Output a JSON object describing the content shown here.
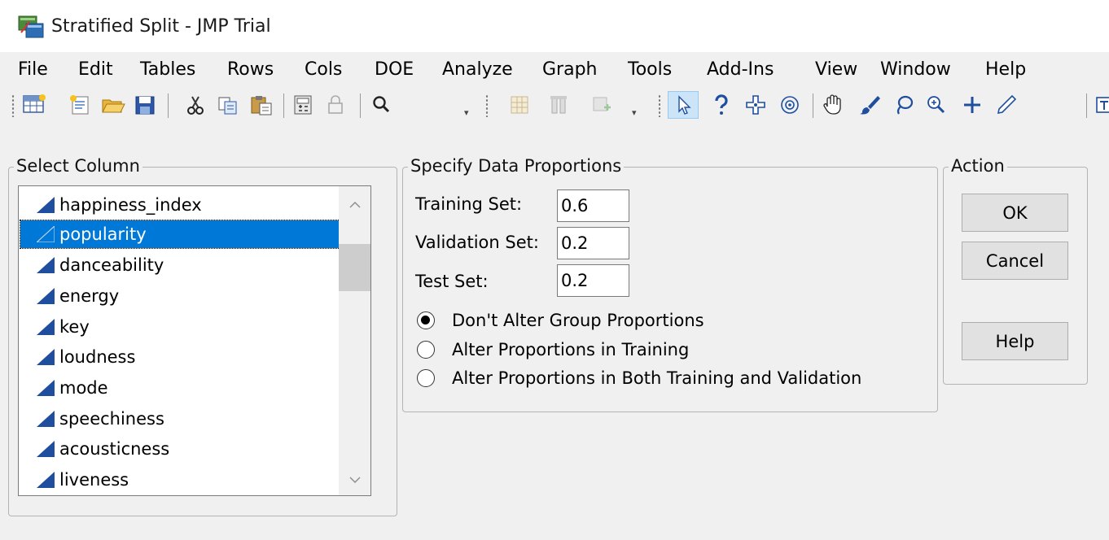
{
  "window": {
    "title": "Stratified Split - JMP Trial",
    "icon": "jmp-app-icon"
  },
  "menu": [
    "File",
    "Edit",
    "Tables",
    "Rows",
    "Cols",
    "DOE",
    "Analyze",
    "Graph",
    "Tools",
    "Add-Ins",
    "View",
    "Window",
    "Help"
  ],
  "toolbar_icons": [
    "new-data-table-icon",
    "new-script-icon",
    "open-folder-icon",
    "save-icon",
    "cut-icon",
    "copy-icon",
    "paste-icon",
    "calculator-icon",
    "lock-icon",
    "search-icon",
    "data-grid-icon",
    "columns-icon",
    "chart-icon",
    "arrow-pointer-icon",
    "help-question-icon",
    "crosshair-icon",
    "target-icon",
    "hand-icon",
    "brush-icon",
    "lasso-icon",
    "zoom-in-icon",
    "plus-icon",
    "pencil-icon"
  ],
  "select_column": {
    "label": "Select Column",
    "items": [
      {
        "name": "happiness_index",
        "selected": false
      },
      {
        "name": "popularity",
        "selected": true
      },
      {
        "name": "danceability",
        "selected": false
      },
      {
        "name": "energy",
        "selected": false
      },
      {
        "name": "key",
        "selected": false
      },
      {
        "name": "loudness",
        "selected": false
      },
      {
        "name": "mode",
        "selected": false
      },
      {
        "name": "speechiness",
        "selected": false
      },
      {
        "name": "acousticness",
        "selected": false
      },
      {
        "name": "liveness",
        "selected": false
      }
    ]
  },
  "proportions": {
    "label": "Specify Data Proportions",
    "training_label": "Training Set:",
    "training_value": "0.6",
    "validation_label": "Validation Set:",
    "validation_value": "0.2",
    "test_label": "Test Set:",
    "test_value": "0.2",
    "options": [
      {
        "label": "Don't Alter Group Proportions",
        "checked": true
      },
      {
        "label": "Alter Proportions in Training",
        "checked": false
      },
      {
        "label": "Alter Proportions in Both Training and Validation",
        "checked": false
      }
    ]
  },
  "action": {
    "label": "Action",
    "ok": "OK",
    "cancel": "Cancel",
    "help": "Help"
  },
  "colors": {
    "selection": "#0078d7",
    "column_icon": "#1f4e9e",
    "background": "#f0f0f0"
  }
}
